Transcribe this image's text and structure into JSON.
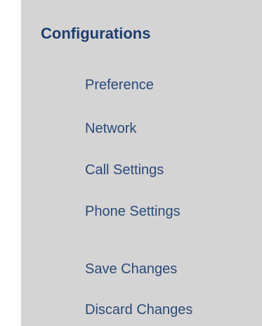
{
  "sidebar": {
    "title": "Configurations",
    "items": [
      {
        "label": "Preference"
      },
      {
        "label": "Network"
      },
      {
        "label": "Call Settings"
      },
      {
        "label": "Phone Settings"
      }
    ],
    "actions": [
      {
        "label": "Save Changes"
      },
      {
        "label": "Discard Changes"
      }
    ]
  },
  "colors": {
    "panel_background": "#d4d4d4",
    "title_color": "#1f3e6e",
    "link_color": "#2b4a78"
  }
}
